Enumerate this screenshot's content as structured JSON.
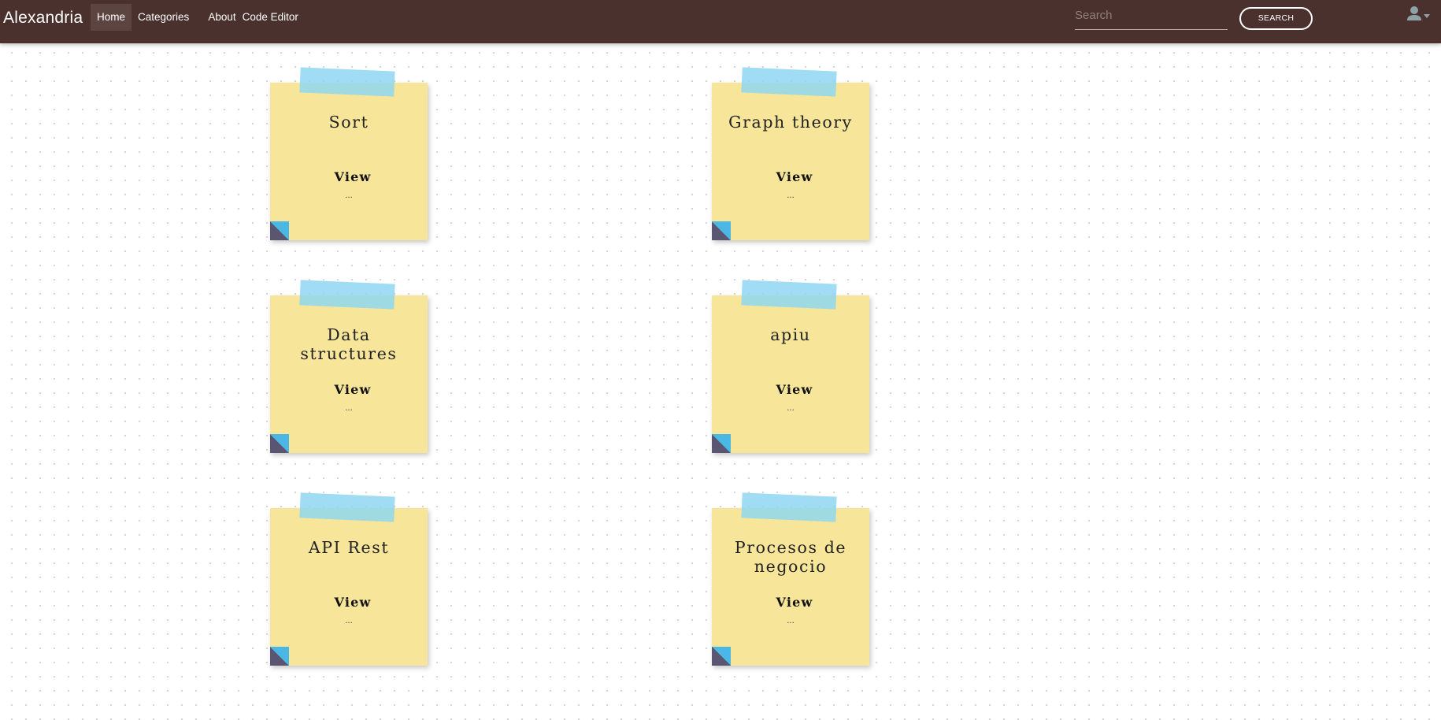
{
  "navbar": {
    "brand": "Alexandria",
    "links": [
      {
        "label": "Home",
        "active": true
      },
      {
        "label": "Categories",
        "active": false
      },
      {
        "label": "About",
        "active": false
      },
      {
        "label": "Code Editor",
        "active": false
      }
    ],
    "search": {
      "value": "",
      "placeholder": "Search"
    },
    "search_button": "SEARCH",
    "user_icon": "user-icon",
    "user_caret_icon": "caret-down-icon"
  },
  "notes": [
    {
      "title": "Sort",
      "view_label": "View",
      "ellipsis": "..."
    },
    {
      "title": "Graph theory",
      "view_label": "View",
      "ellipsis": "..."
    },
    {
      "title": "Data structures",
      "view_label": "View",
      "ellipsis": "..."
    },
    {
      "title": "apiu",
      "view_label": "View",
      "ellipsis": "..."
    },
    {
      "title": "API Rest",
      "view_label": "View",
      "ellipsis": "..."
    },
    {
      "title": "Procesos de negocio",
      "view_label": "View",
      "ellipsis": "..."
    }
  ],
  "colors": {
    "navbar": "#4a312d",
    "note": "#f7e59a",
    "tape": "#8bd6f1",
    "corner_dark": "#5a5570",
    "corner_light": "#4bb7e4"
  }
}
